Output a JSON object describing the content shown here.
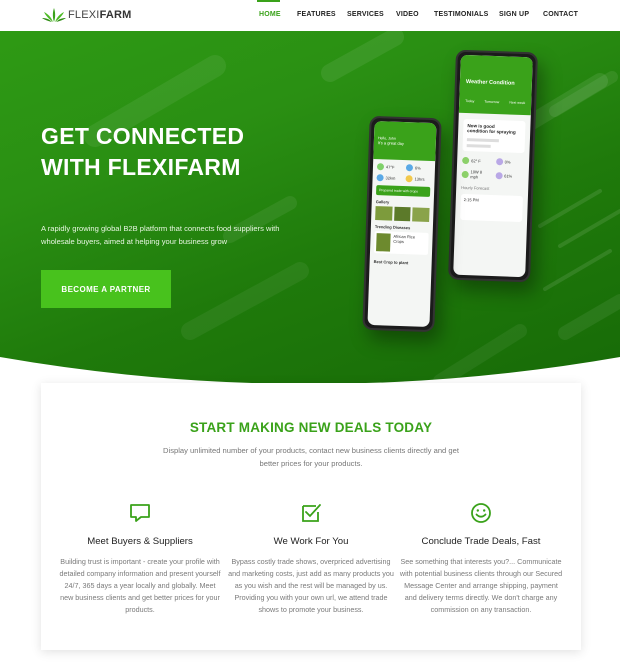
{
  "brand": {
    "name_light": "FLEXI",
    "name_bold": "FARM",
    "accent_color": "#3aa21a",
    "button_color": "#48c21d"
  },
  "nav": {
    "items": [
      {
        "label": "HOME",
        "active": true
      },
      {
        "label": "FEATURES",
        "active": false
      },
      {
        "label": "SERVICES",
        "active": false
      },
      {
        "label": "VIDEO",
        "active": false
      },
      {
        "label": "TESTIMONIALS",
        "active": false
      },
      {
        "label": "SIGN UP",
        "active": false
      },
      {
        "label": "CONTACT",
        "active": false
      }
    ]
  },
  "hero": {
    "title_line1": "GET CONNECTED",
    "title_line2": "WITH FLEXIFARM",
    "subtitle": "A rapidly growing global B2B platform that connects food suppliers with wholesale buyers, aimed at helping your business grow",
    "cta_label": "BECOME A PARTNER"
  },
  "phone_front": {
    "greeting": "Hello, John",
    "header": "It's a great day",
    "stats": [
      "47°F",
      "6%",
      "32km",
      "13hrs"
    ],
    "banner": "Prepared trade with crops",
    "gallery_label": "Gallery",
    "diseases_label": "Trending Diseases",
    "disease_name": "African Rice Crops",
    "footer_label": "Best Crop to plant"
  },
  "phone_back": {
    "title": "Weather Condition",
    "tabs": [
      "Today",
      "Tomorrow",
      "Next week"
    ],
    "condition_line1": "Now is good",
    "condition_line2": "condition for spraying",
    "readings": [
      "62° F",
      "0%",
      "10W 8 mph",
      "61%"
    ],
    "hourly_label": "Hourly Forecast",
    "time": "2:15 PM"
  },
  "section": {
    "title": "START MAKING NEW DEALS TODAY",
    "subtitle": "Display unlimited number of your products, contact new business clients directly and get better prices for your products."
  },
  "features": [
    {
      "icon": "chat-bubble-icon",
      "title": "Meet Buyers & Suppliers",
      "text": "Building trust is important - create your profile with detailed company information and present yourself 24/7, 365 days a year locally and globally. Meet new business clients and get better prices for your products."
    },
    {
      "icon": "checkbox-icon",
      "title": "We Work For You",
      "text": "Bypass costly trade shows, overpriced advertising and marketing costs, just add as many products you as you wish and the rest will be managed by us. Providing you with your own url, we attend trade shows to promote your business."
    },
    {
      "icon": "smiley-icon",
      "title": "Conclude Trade Deals, Fast",
      "text": "See something that interests you?... Communicate with potential business clients through our Secured Message Center and arrange shipping, payment and delivery terms directly. We don't charge any commission on any transaction."
    }
  ]
}
